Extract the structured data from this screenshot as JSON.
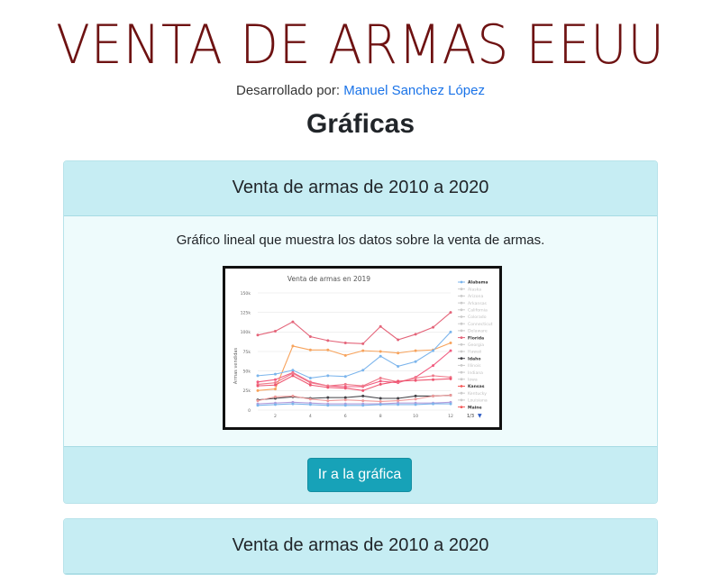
{
  "header": {
    "title": "VENTA DE ARMAS EEUU",
    "byline_prefix": "Desarrollado por:",
    "author": "Manuel Sanchez López"
  },
  "section_title": "Gráficas",
  "cards": [
    {
      "header": "Venta de armas de 2010 a 2020",
      "description": "Gráfico lineal que muestra los datos sobre la venta de armas.",
      "button_label": "Ir a la gráfica"
    },
    {
      "header": "Venta de armas de 2010 a 2020"
    }
  ],
  "chart_data": {
    "type": "line",
    "title": "Venta de armas en 2019",
    "xlabel": "",
    "ylabel": "Armas vendidas",
    "x": [
      1,
      2,
      3,
      4,
      5,
      6,
      7,
      8,
      9,
      10,
      11,
      12
    ],
    "xticks": [
      "2",
      "4",
      "6",
      "8",
      "10",
      "12"
    ],
    "yticks": [
      "0",
      "25k",
      "50k",
      "75k",
      "100k",
      "125k",
      "150k"
    ],
    "ylim": [
      0,
      150000
    ],
    "grid": true,
    "legend_position": "right",
    "legend_pager": "1/3",
    "legend": [
      {
        "name": "Alabama",
        "color": "#7cb5ec",
        "active": true
      },
      {
        "name": "Alaska",
        "color": "#f7a35c",
        "active": false
      },
      {
        "name": "Arizona",
        "color": "#90a4ae",
        "active": false
      },
      {
        "name": "Arkansas",
        "color": "#b0bec5",
        "active": false
      },
      {
        "name": "California",
        "color": "#f7a35c",
        "active": false
      },
      {
        "name": "Colorado",
        "color": "#a1887f",
        "active": false
      },
      {
        "name": "Connecticut",
        "color": "#f15c80",
        "active": false
      },
      {
        "name": "Delaware",
        "color": "#9e9e9e",
        "active": false
      },
      {
        "name": "Florida",
        "color": "#e4657a",
        "active": true
      },
      {
        "name": "Georgia",
        "color": "#90caf9",
        "active": false
      },
      {
        "name": "Hawaii",
        "color": "#f7a35c",
        "active": false
      },
      {
        "name": "Idaho",
        "color": "#434348",
        "active": true
      },
      {
        "name": "Illinois",
        "color": "#9fa8da",
        "active": false
      },
      {
        "name": "Indiana",
        "color": "#b39ddb",
        "active": false
      },
      {
        "name": "Iowa",
        "color": "#ef9a9a",
        "active": false
      },
      {
        "name": "Kansas",
        "color": "#f45b5b",
        "active": true
      },
      {
        "name": "Kentucky",
        "color": "#bcaaa4",
        "active": false
      },
      {
        "name": "Louisiana",
        "color": "#b0bec5",
        "active": false
      },
      {
        "name": "Maine",
        "color": "#f45b5b",
        "active": true
      }
    ],
    "series": [
      {
        "color": "#e4657a",
        "values": [
          96000,
          101000,
          113000,
          94000,
          89000,
          86000,
          85000,
          107000,
          90000,
          97000,
          106000,
          125000
        ]
      },
      {
        "color": "#f7a35c",
        "values": [
          25000,
          27000,
          82000,
          77000,
          77000,
          70000,
          76000,
          75000,
          73000,
          76000,
          77000,
          86000
        ]
      },
      {
        "color": "#7cb5ec",
        "values": [
          44000,
          46000,
          51000,
          41000,
          44000,
          43000,
          51000,
          69000,
          56000,
          62000,
          76000,
          100000
        ]
      },
      {
        "color": "#f15c80",
        "values": [
          36000,
          39000,
          48000,
          36000,
          31000,
          30000,
          30000,
          37000,
          35000,
          42000,
          57000,
          76000
        ]
      },
      {
        "color": "#ef7a8a",
        "values": [
          33000,
          35000,
          47000,
          35000,
          31000,
          33000,
          31000,
          41000,
          36000,
          41000,
          44000,
          42000
        ]
      },
      {
        "color": "#ee5570",
        "values": [
          31000,
          32000,
          44000,
          32000,
          29000,
          28000,
          25000,
          33000,
          37000,
          38000,
          39000,
          40000
        ]
      },
      {
        "color": "#434348",
        "values": [
          13000,
          15000,
          17000,
          15000,
          16000,
          16000,
          18000,
          15000,
          15000,
          18000,
          18000,
          19000
        ]
      },
      {
        "color": "#ef9a9a",
        "values": [
          12000,
          17000,
          18000,
          14000,
          12000,
          13000,
          12000,
          11000,
          12000,
          14000,
          18000,
          19000
        ]
      },
      {
        "color": "#b39ddb",
        "values": [
          8000,
          9000,
          10000,
          9000,
          8000,
          8000,
          8000,
          8000,
          9000,
          9000,
          9000,
          10000
        ]
      },
      {
        "color": "#7cb5ec",
        "values": [
          6000,
          7000,
          8000,
          7000,
          6000,
          6000,
          6000,
          7000,
          7000,
          7000,
          8000,
          8000
        ]
      }
    ]
  }
}
